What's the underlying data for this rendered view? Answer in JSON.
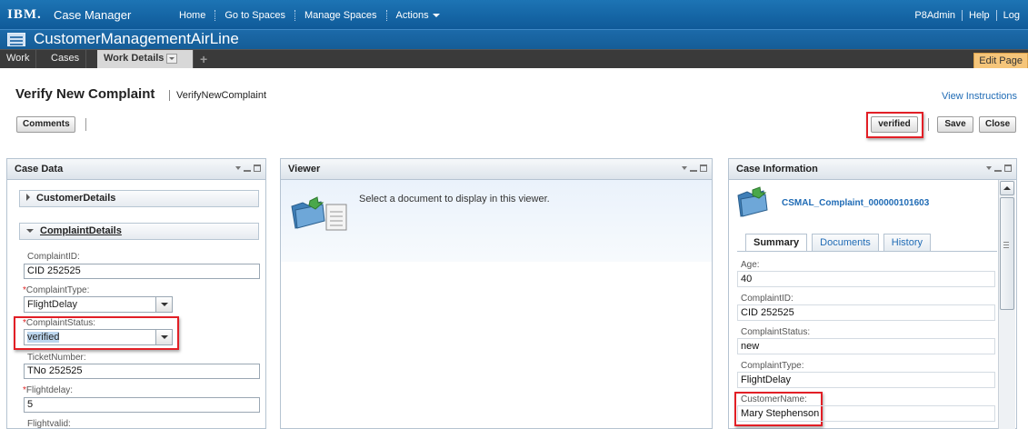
{
  "topbar": {
    "logo": "IBM.",
    "app_name": "Case Manager",
    "nav": [
      "Home",
      "Go to Spaces",
      "Manage Spaces",
      "Actions"
    ],
    "user": "P8Admin",
    "help": "Help",
    "log": "Log"
  },
  "solution": {
    "title": "CustomerManagementAirLine"
  },
  "tabs": {
    "work": "Work",
    "cases": "Cases",
    "work_details": "Work Details",
    "add": "+",
    "edit_page": "Edit Page"
  },
  "header": {
    "title": "Verify New Complaint",
    "subtitle": "VerifyNewComplaint",
    "view_instructions": "View Instructions",
    "comments_button": "Comments",
    "verified_button": "verified",
    "save_button": "Save",
    "close_button": "Close"
  },
  "case_data": {
    "title": "Case Data",
    "section_customer": "CustomerDetails",
    "section_complaint": "ComplaintDetails",
    "fields": {
      "complaint_id_label": "ComplaintID:",
      "complaint_id_value": "CID 252525",
      "complaint_type_label": "ComplaintType:",
      "complaint_type_value": "FlightDelay",
      "complaint_status_label": "ComplaintStatus:",
      "complaint_status_value": "verified",
      "ticket_number_label": "TicketNumber:",
      "ticket_number_value": "TNo 252525",
      "flightdelay_label": "Flightdelay:",
      "flightdelay_value": "5",
      "flightvalid_label": "Flightvalid:"
    },
    "required_marker": "*"
  },
  "viewer": {
    "title": "Viewer",
    "message": "Select a document to display in this viewer."
  },
  "case_info": {
    "title": "Case Information",
    "case_name": "CSMAL_Complaint_000000101603",
    "tabs": [
      "Summary",
      "Documents",
      "History"
    ],
    "properties": [
      {
        "label": "Age:",
        "value": "40"
      },
      {
        "label": "ComplaintID:",
        "value": "CID 252525"
      },
      {
        "label": "ComplaintStatus:",
        "value": "new"
      },
      {
        "label": "ComplaintType:",
        "value": "FlightDelay"
      },
      {
        "label": "CustomerName:",
        "value": "Mary Stephenson"
      }
    ]
  },
  "colors": {
    "topbar": "#1d74b4",
    "highlight_box": "#e21f26",
    "link": "#1f6bb5",
    "edit_page_bg": "#f5c57a"
  }
}
